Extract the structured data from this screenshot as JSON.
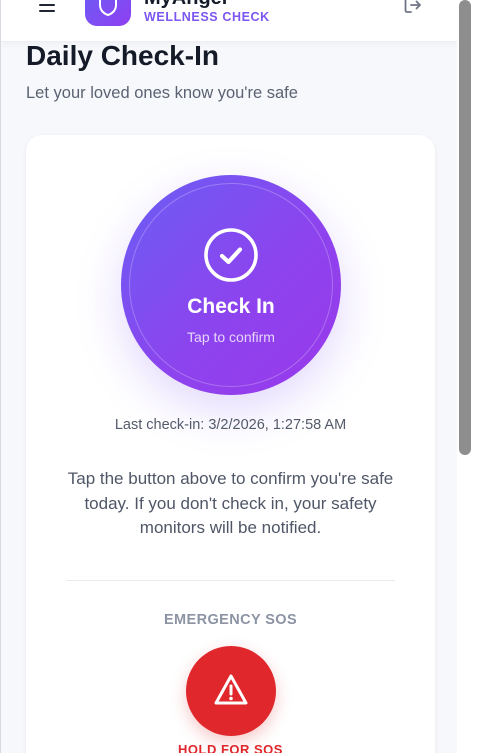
{
  "header": {
    "app_name": "MyAngel",
    "app_subtitle": "WELLNESS CHECK",
    "icons": {
      "menu": "hamburger-menu-icon",
      "logo": "shield-icon",
      "logout": "logout-icon"
    },
    "accent_color": "#7c56f0"
  },
  "page": {
    "title": "Daily Check-In",
    "subtitle": "Let your loved ones know you're safe"
  },
  "checkin": {
    "label": "Check In",
    "sublabel": "Tap to confirm",
    "icon": "check-circle-icon",
    "gradient_start": "#6a5ef4",
    "gradient_end": "#9a38ea",
    "last_checkin": "Last check-in: 3/2/2026, 1:27:58 AM",
    "info": "Tap the button above to confirm you're safe today. If you don't check in, your safety monitors will be notified."
  },
  "sos": {
    "heading": "EMERGENCY SOS",
    "icon": "warning-triangle-icon",
    "label": "HOLD FOR SOS",
    "color": "#e0272b"
  }
}
